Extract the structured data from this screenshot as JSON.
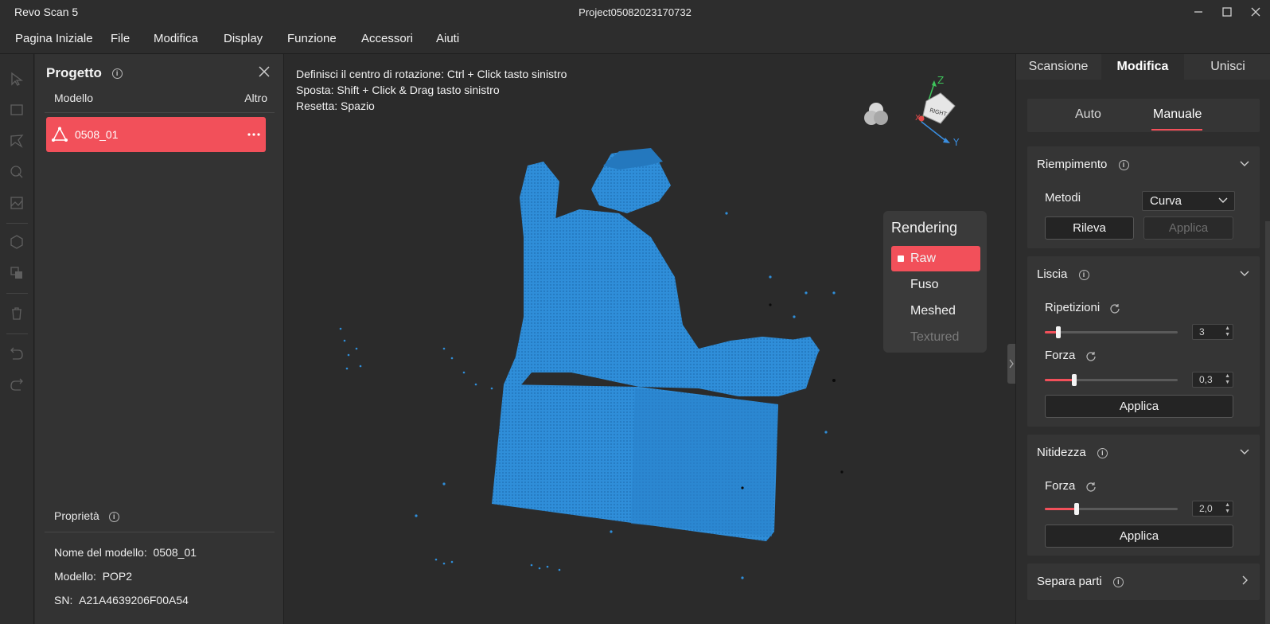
{
  "window": {
    "app_title": "Revo Scan 5",
    "project_title": "Project05082023170732"
  },
  "menu": [
    "Pagina Iniziale",
    "File",
    "Modifica",
    "Display",
    "Funzione",
    "Accessori",
    "Aiuti"
  ],
  "project_panel": {
    "title": "Progetto",
    "col_model": "Modello",
    "col_more": "Altro",
    "model_name": "0508_01",
    "properties_title": "Proprietà",
    "properties": [
      {
        "label": "Nome del modello:",
        "value": "0508_01"
      },
      {
        "label": "Modello:",
        "value": "POP2"
      },
      {
        "label": "SN:",
        "value": "A21A4639206F00A54"
      }
    ]
  },
  "viewport": {
    "hints": [
      "Definisci il centro di rotazione: Ctrl + Click tasto sinistro",
      "Sposta: Shift + Click & Drag tasto sinistro",
      "Resetta: Spazio"
    ],
    "cube_face": "RIGHT",
    "axes": {
      "z": "Z",
      "y": "Y",
      "x": "X"
    },
    "rendering": {
      "title": "Rendering",
      "options": [
        "Raw",
        "Fuso",
        "Meshed",
        "Textured"
      ],
      "selected": "Raw",
      "disabled": "Textured"
    }
  },
  "right_panel": {
    "tabs": [
      "Scansione",
      "Modifica",
      "Unisci"
    ],
    "active_tab": "Modifica",
    "modes": [
      "Auto",
      "Manuale"
    ],
    "active_mode": "Manuale",
    "riempimento": {
      "title": "Riempimento",
      "method_label": "Metodi",
      "method_value": "Curva",
      "detect_button": "Rileva",
      "apply_button": "Applica"
    },
    "liscia": {
      "title": "Liscia",
      "repetitions_label": "Ripetizioni",
      "repetitions_value": "3",
      "repetitions_fraction": 0.1,
      "strength_label": "Forza",
      "strength_value": "0,3",
      "strength_fraction": 0.22,
      "apply_button": "Applica"
    },
    "nitidezza": {
      "title": "Nitidezza",
      "strength_label": "Forza",
      "strength_value": "2,0",
      "strength_fraction": 0.24,
      "apply_button": "Applica"
    },
    "separa": {
      "title": "Separa parti"
    }
  },
  "colors": {
    "accent": "#f2505a",
    "point_cloud": "#2f8ed9",
    "background": "#2b2b2b"
  }
}
